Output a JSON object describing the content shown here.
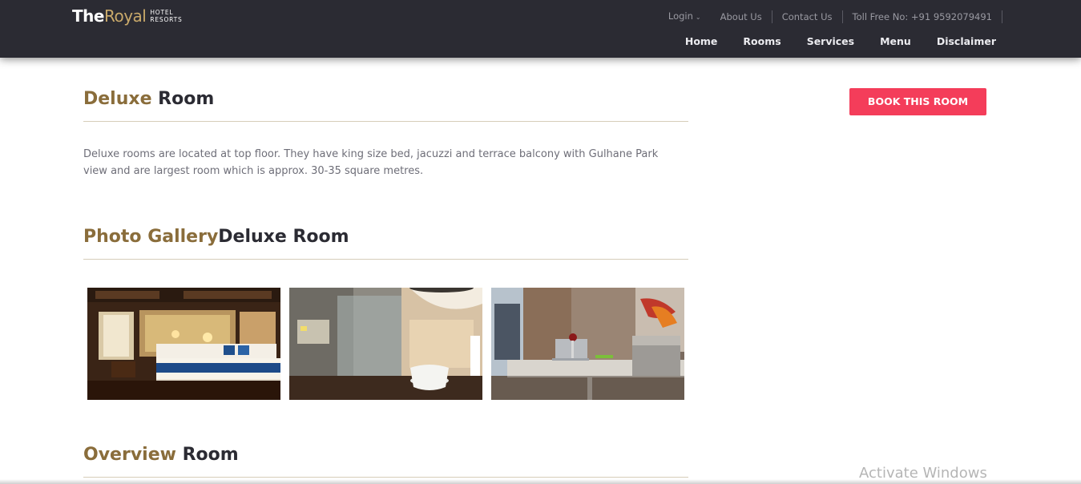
{
  "brand": {
    "the": "The",
    "royal": "Royal",
    "line1": "HOTEL",
    "line2": "RESORTS"
  },
  "topbar": {
    "login": "Login",
    "about": "About Us",
    "contact": "Contact Us",
    "tollfree": "Toll Free No: +91 9592079491"
  },
  "nav": {
    "home": "Home",
    "rooms": "Rooms",
    "services": "Services",
    "menu": "Menu",
    "disclaimer": "Disclaimer"
  },
  "room": {
    "title_accent": "Deluxe",
    "title_rest": " Room",
    "description": "Deluxe rooms are located at top floor. They have king size bed, jacuzzi and terrace balcony with Gulhane Park view and are largest room which is approx. 30-35 square metres."
  },
  "gallery": {
    "title_accent": "Photo Gallery",
    "title_rest": "Deluxe Room"
  },
  "overview": {
    "title_accent": "Overview",
    "title_rest": " Room"
  },
  "book_button": "BOOK THIS ROOM",
  "watermark": "Activate Windows",
  "colors": {
    "header_bg": "#2b2b33",
    "accent_gold": "#8a6d3b",
    "book_red": "#f43d5a"
  }
}
